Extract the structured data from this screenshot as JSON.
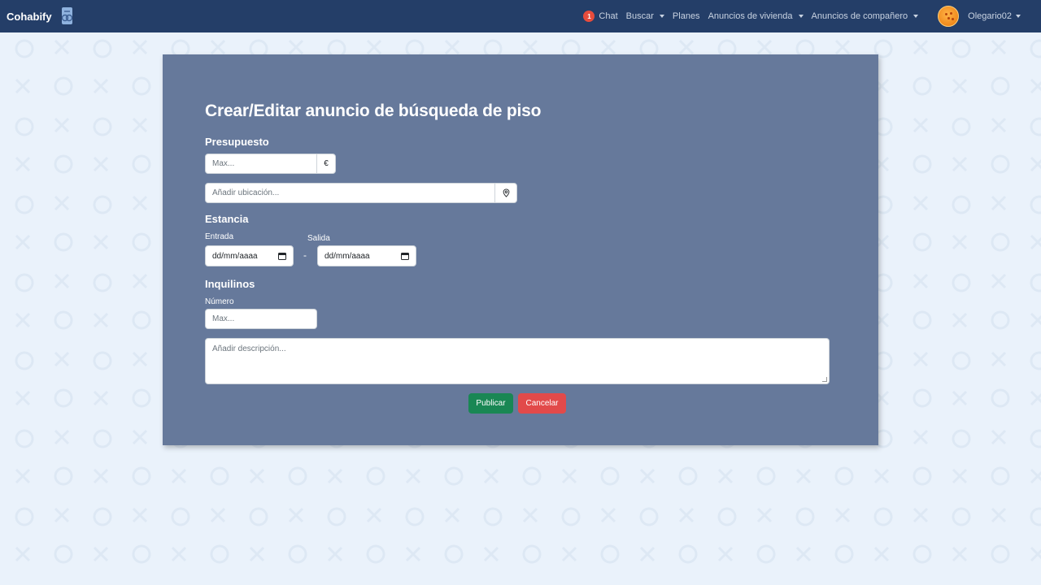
{
  "navbar": {
    "brand": "Cohabify",
    "chat_badge": "1",
    "chat_label": "Chat",
    "buscar_label": "Buscar",
    "planes_label": "Planes",
    "vivienda_label": "Anuncios de vivienda",
    "companero_label": "Anuncios de compañero",
    "username": "Olegario02"
  },
  "form": {
    "title": "Crear/Editar anuncio de búsqueda de piso",
    "presupuesto_label": "Presupuesto",
    "budget_placeholder": "Max...",
    "currency_symbol": "€",
    "location_placeholder": "Añadir ubicación...",
    "estancia_label": "Estancia",
    "entrada_label": "Entrada",
    "salida_label": "Salida",
    "entrada_value": "dd/mm/aaaa",
    "salida_value": "dd/mm/aaaa",
    "date_separator": "-",
    "inquilinos_label": "Inquilinos",
    "numero_label": "Número",
    "numero_placeholder": "Max...",
    "description_placeholder": "Añadir descripción...",
    "publish_button": "Publicar",
    "cancel_button": "Cancelar"
  },
  "colors": {
    "navbar_bg": "#243e68",
    "card_bg": "#66799b",
    "page_bg": "#eaf2fb",
    "success": "#198754",
    "danger": "#e24a4a",
    "badge": "#e74c3c"
  }
}
